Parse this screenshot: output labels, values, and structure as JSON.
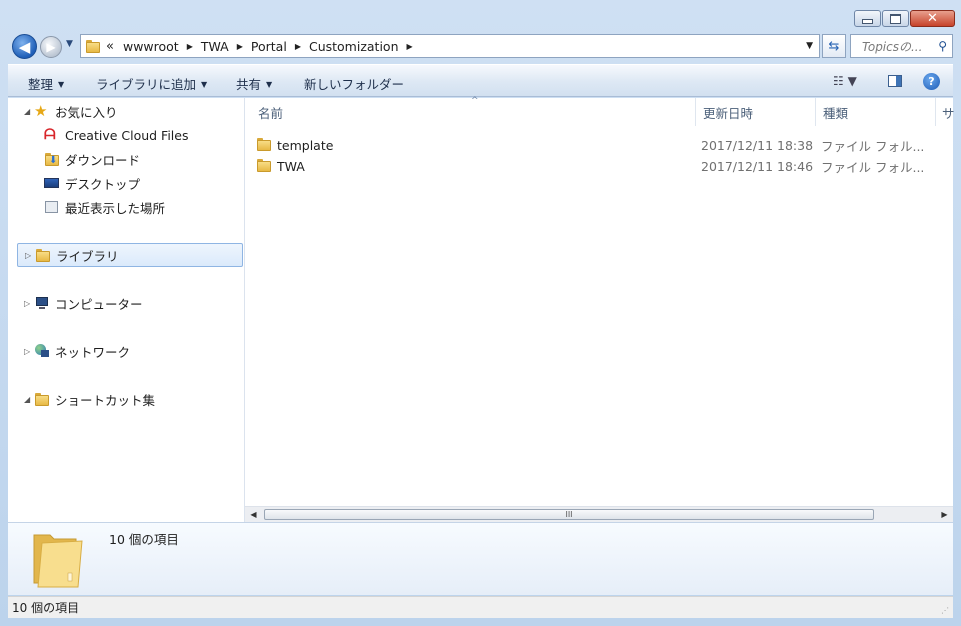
{
  "window": {
    "controls": [
      "minimize",
      "maximize",
      "close"
    ]
  },
  "nav": {
    "breadcrumb_lead": "«",
    "breadcrumbs": [
      "wwwroot",
      "TWA",
      "Portal",
      "Customization"
    ],
    "search_placeholder": "Topicsの..."
  },
  "toolbar": {
    "organize": "整理",
    "add_to_library": "ライブラリに追加",
    "share": "共有",
    "new_folder": "新しいフォルダー"
  },
  "sidebar": {
    "favorites": "お気に入り",
    "creative_cloud": "Creative Cloud Files",
    "downloads": "ダウンロード",
    "desktop": "デスクトップ",
    "recent": "最近表示した場所",
    "libraries": "ライブラリ",
    "computer": "コンピューター",
    "network": "ネットワーク",
    "shortcuts": "ショートカット集"
  },
  "columns": {
    "name": "名前",
    "modified": "更新日時",
    "type": "種類",
    "size": "サ"
  },
  "files": [
    {
      "name": "template",
      "modified": "2017/12/11 18:38",
      "type": "ファイル フォル..."
    },
    {
      "name": "TWA",
      "modified": "2017/12/11 18:46",
      "type": "ファイル フォル..."
    }
  ],
  "scrollbar": {
    "grip": "III"
  },
  "details": {
    "count": "10 個の項目"
  },
  "status": {
    "text": "10 個の項目"
  },
  "colors": {
    "accent": "#2562b3",
    "folder": "#e7b945",
    "selection": "#dbeafb"
  }
}
